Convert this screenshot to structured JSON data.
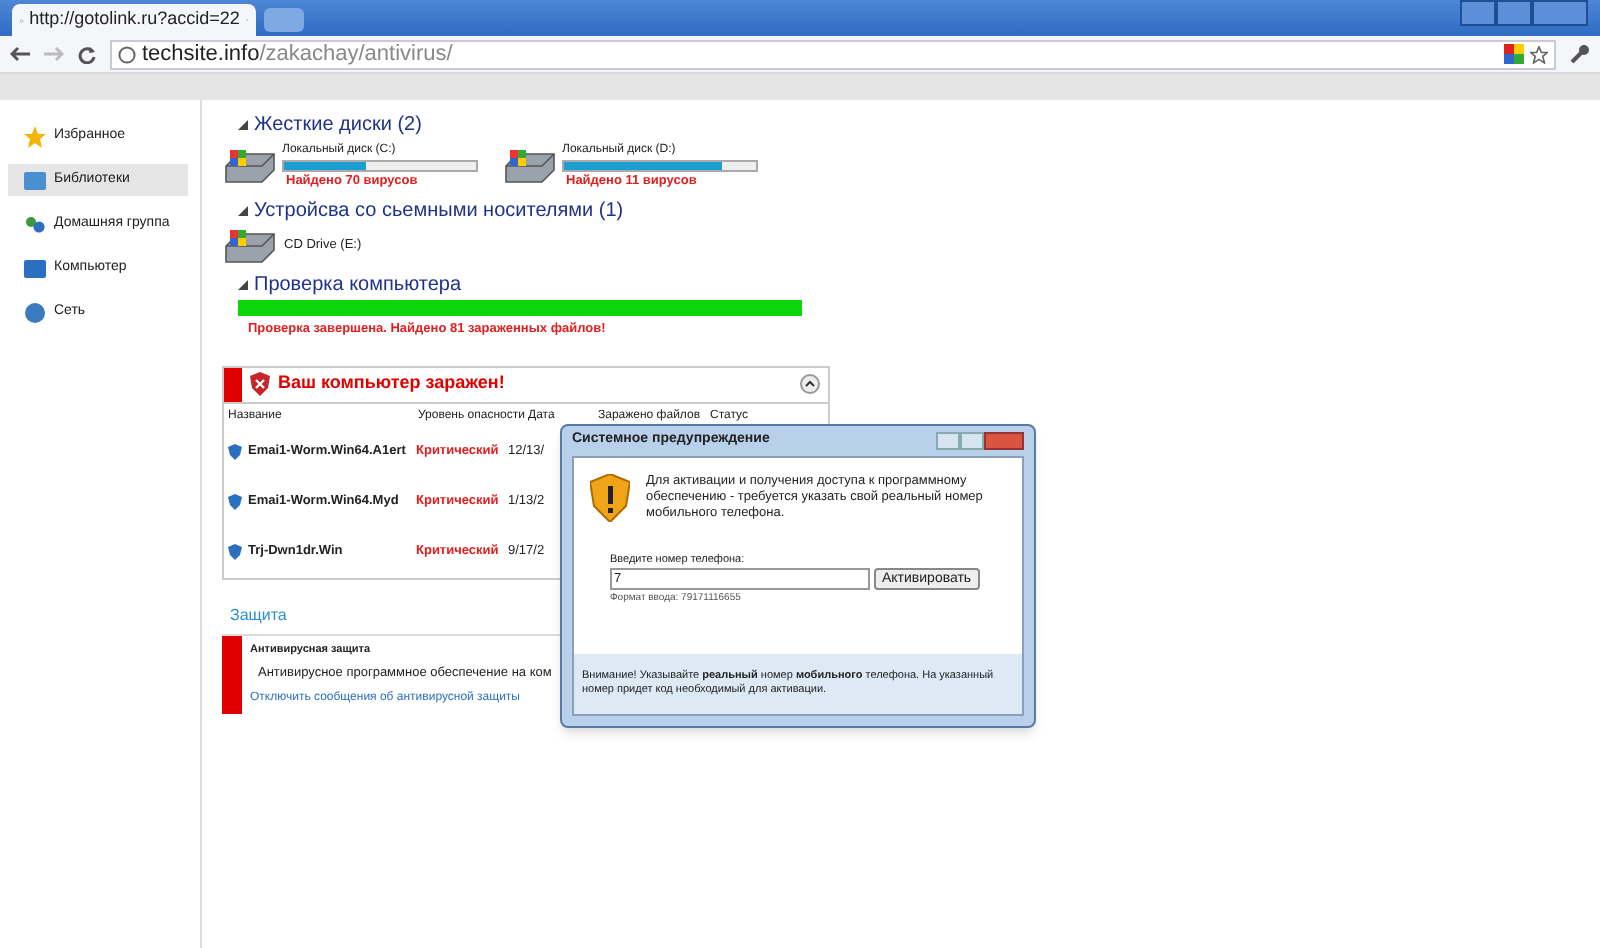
{
  "browser": {
    "tab_title": "http://gotolink.ru?accid=22",
    "url_host": "techsite.info",
    "url_path": "/zakachay/antivirus/"
  },
  "sidebar": {
    "items": [
      {
        "label": "Избранное",
        "selected": false
      },
      {
        "label": "Библиотеки",
        "selected": true
      },
      {
        "label": "Домашняя группа",
        "selected": false
      },
      {
        "label": "Компьютер",
        "selected": false
      },
      {
        "label": "Сеть",
        "selected": false
      }
    ]
  },
  "hard_drives": {
    "title": "Жесткие диски (2)",
    "drives": [
      {
        "name": "Локальный диск (C:)",
        "level": 0.43,
        "status": "Найдено 70 вирусов"
      },
      {
        "name": "Локальный диск (D:)",
        "level": 0.82,
        "status": "Найдено 11 вирусов"
      }
    ]
  },
  "removable": {
    "title": "Устройсва со сьемными носителями (1)",
    "drives": [
      {
        "name": "CD Drive (E:)"
      }
    ]
  },
  "scan": {
    "title": "Проверка компьютера",
    "level": 1,
    "result": "Проверка завершена. Найдено 81 зараженных файлов!"
  },
  "infected": {
    "title": "Ваш компьютер заражен!",
    "columns": [
      "Название",
      "Уровень опасности",
      "Дата",
      "Заражено файлов",
      "Статус"
    ],
    "rows": [
      {
        "name": "Emai1-Worm.Win64.A1ert",
        "level": "Критический",
        "date": "12/13/"
      },
      {
        "name": "Emai1-Worm.Win64.Myd",
        "level": "Критический",
        "date": "1/13/2"
      },
      {
        "name": "Trj-Dwn1dr.Win",
        "level": "Критический",
        "date": "9/17/2"
      }
    ]
  },
  "protection": {
    "title": "Защита",
    "heading": "Антивирусная защита",
    "text": "Антивирусное программное обеспечение на ком",
    "link": "Отключить сообщения об антивирусной защиты"
  },
  "dialog": {
    "title": "Системное предупреждение",
    "message": "Для активации и получения доступа к программному обеспечению - требуется указать свой реальный номер мобильного телефона.",
    "field_label": "Введите номер телефона:",
    "field_value": "7",
    "button": "Активировать",
    "format_hint": "Формат ввода: 79171116655",
    "footer": "Внимание! Указывайте **реальный** номер **мобильного** телефона. На указанный номер придет код необходимый для активации."
  }
}
